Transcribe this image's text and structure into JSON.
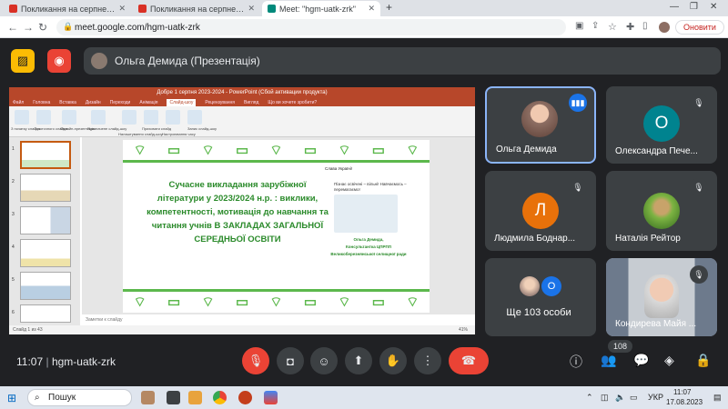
{
  "browser": {
    "tabs": [
      {
        "title": "Покликання на серпневу методи"
      },
      {
        "title": "Покликання на серпневу методи"
      },
      {
        "title": "Meet: \"hgm-uatk-zrk\""
      }
    ],
    "new_tab": "+",
    "url": "meet.google.com/hgm-uatk-zrk",
    "update_button": "Оновити"
  },
  "meet": {
    "presenter_label": "Ольга Демида (Презентація)",
    "meeting_code": "hgm-uatk-zrk",
    "time": "11:07",
    "participants_count": "108",
    "more_label": "Ще 103 особи"
  },
  "participants": [
    {
      "name": "Ольга Демида",
      "initial": "",
      "color": "#5d4037"
    },
    {
      "name": "Олександра Пече...",
      "initial": "О",
      "color": "#00838f"
    },
    {
      "name": "Людмила Боднар...",
      "initial": "Л",
      "color": "#e8710a"
    },
    {
      "name": "Наталія Рейтор",
      "initial": "",
      "color": "#7cb342"
    },
    {
      "name": "Кондирева Майя ...",
      "initial": "",
      "color": "#9fa8b5"
    }
  ],
  "more_avatar_initial": "О",
  "powerpoint": {
    "title": "Добре 1 серпня 2023-2024 - PowerPoint (Сбой активации продукта)",
    "menu": [
      "Файл",
      "Головна",
      "Вставка",
      "Дизайн",
      "Переходи",
      "Анімація",
      "Слайд-шоу",
      "Рецензування",
      "Вигляд",
      "Що ви хочете зробити?"
    ],
    "ribbon_labels": [
      "З початку слайда",
      "З поточного слайда",
      "Онлайн-презентація",
      "Призначене слайд-шоу",
      "Налаштування слайд-шоу",
      "Приховати слайд",
      "Настроювання часу",
      "Запис слайд-шоу"
    ],
    "notes_placeholder": "Заметки к слайду",
    "status_left": "Слайд 1 из 43",
    "status_right": "41%",
    "slide_numbers": [
      "1",
      "2",
      "3",
      "4",
      "5",
      "6"
    ]
  },
  "slide": {
    "heading": "Сучасне викладання зарубіжної літератури у 2023/2024 н.р. : виклики, компетентності, мотивація до навчання та читання учнів В ЗАКЛАДАХ ЗАГАЛЬНОЇ СЕРЕДНЬОЇ ОСВІТИ",
    "slogan": "Слава Україні!",
    "quote": "Пізнає освічені – вільні! Навчаємось – перемагаємо!",
    "author": "Ольга Демида,",
    "author_role": "Консультантка ЦПРПП",
    "author_org": "Великоберезнянської селищної ради"
  },
  "taskbar": {
    "search_label": "Пошук",
    "lang": "УКР",
    "clock_time": "11:07",
    "clock_date": "17.08.2023"
  },
  "colors": {
    "accent": "#8ab4f8",
    "danger": "#ea4335",
    "slide_green": "#2a8a2a"
  }
}
